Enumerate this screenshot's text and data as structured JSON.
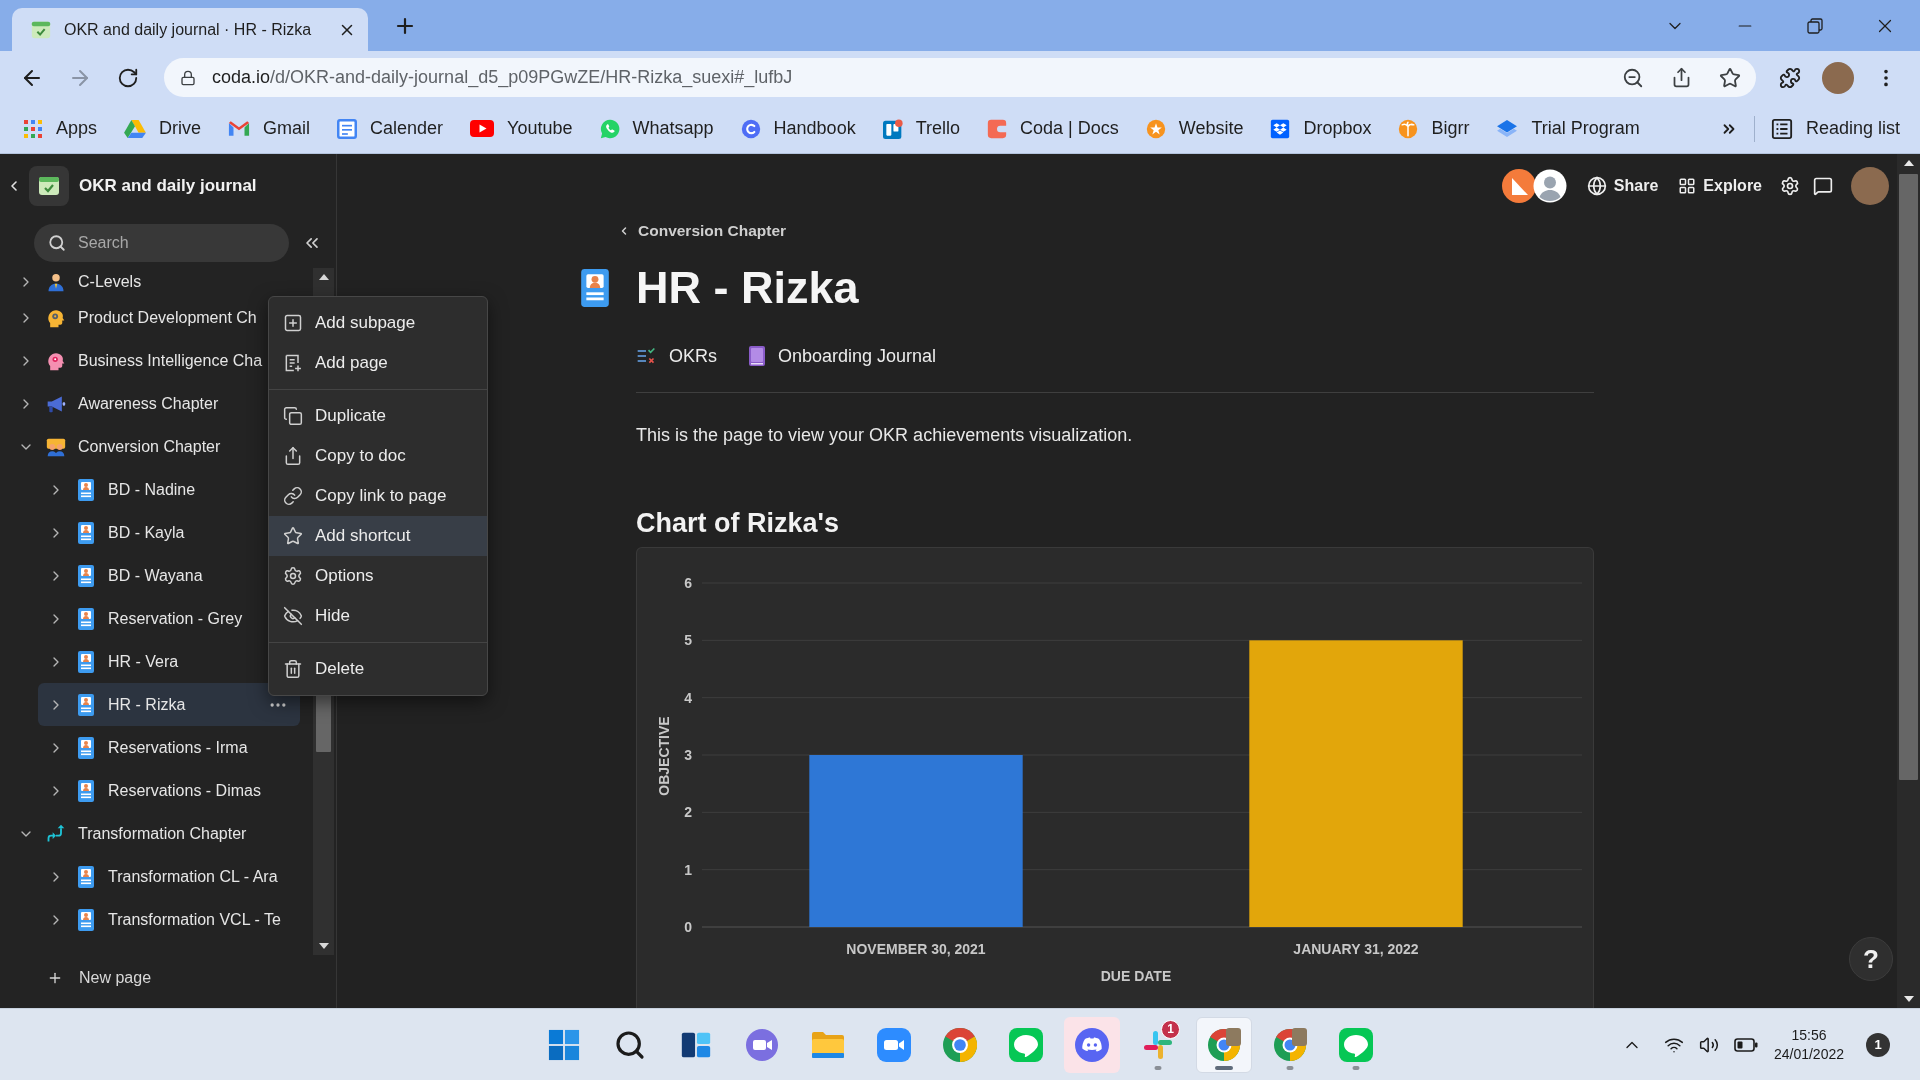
{
  "browser": {
    "tabs": [
      {
        "title": "OKR and daily journal · HR - Rizka",
        "selected": true
      }
    ],
    "can_go_forward": false,
    "address": {
      "host": "coda.io",
      "path": "/d/OKR-and-daily-journal_d5_p09PGwZE/HR-Rizka_suexi#_lufbJ"
    },
    "bookmarks": [
      {
        "label": "Apps",
        "kind": "grid"
      },
      {
        "label": "Drive",
        "kind": "triangle"
      },
      {
        "label": "Gmail",
        "kind": "mail"
      },
      {
        "label": "Calender",
        "kind": "calendar"
      },
      {
        "label": "Youtube",
        "kind": "play"
      },
      {
        "label": "Whatsapp",
        "kind": "phone"
      },
      {
        "label": "Handbook",
        "kind": "swirl"
      },
      {
        "label": "Trello",
        "kind": "board"
      },
      {
        "label": "Coda | Docs",
        "kind": "notch"
      },
      {
        "label": "Website",
        "kind": "star"
      },
      {
        "label": "Dropbox",
        "kind": "box"
      },
      {
        "label": "Bigrr",
        "kind": "palm"
      },
      {
        "label": "Trial Program",
        "kind": "layers"
      }
    ],
    "reading_list": "Reading list"
  },
  "sidebar": {
    "doc_title": "OKR and daily journal",
    "search": {
      "placeholder": "Search"
    },
    "pages": [
      {
        "label": "C-Levels",
        "kind": "leader",
        "expanded": false,
        "selected": false
      },
      {
        "label": "Product Development Ch",
        "kind": "mind",
        "expanded": false,
        "selected": false
      },
      {
        "label": "Business Intelligence Cha",
        "kind": "brain",
        "expanded": false,
        "selected": false
      },
      {
        "label": "Awareness Chapter",
        "kind": "megaphone",
        "expanded": false,
        "selected": false
      },
      {
        "label": "Conversion Chapter",
        "kind": "team",
        "expanded": true,
        "selected": false,
        "children": [
          {
            "label": "BD - Nadine",
            "kind": "card",
            "expanded": false,
            "selected": false
          },
          {
            "label": "BD - Kayla",
            "kind": "card",
            "expanded": false,
            "selected": false
          },
          {
            "label": "BD - Wayana",
            "kind": "card",
            "expanded": false,
            "selected": false
          },
          {
            "label": "Reservation - Grey",
            "kind": "card",
            "expanded": false,
            "selected": false
          },
          {
            "label": "HR - Vera",
            "kind": "card",
            "expanded": false,
            "selected": false
          },
          {
            "label": "HR - Rizka",
            "kind": "card",
            "expanded": false,
            "selected": true
          },
          {
            "label": "Reservations - Irma",
            "kind": "card",
            "expanded": false,
            "selected": false
          },
          {
            "label": "Reservations - Dimas",
            "kind": "card",
            "expanded": false,
            "selected": false
          }
        ]
      },
      {
        "label": "Transformation Chapter",
        "kind": "arrows",
        "expanded": true,
        "selected": false,
        "children": [
          {
            "label": "Transformation CL - Ara",
            "kind": "card",
            "expanded": false,
            "selected": false
          },
          {
            "label": "Transformation VCL - Te",
            "kind": "card",
            "expanded": false,
            "selected": false
          }
        ]
      }
    ],
    "new_page": "New page"
  },
  "context_menu": {
    "sections": [
      {
        "items": [
          {
            "label": "Add subpage",
            "kind": "subpage",
            "selected": false
          },
          {
            "label": "Add page",
            "kind": "page",
            "selected": false
          }
        ]
      },
      {
        "items": [
          {
            "label": "Duplicate",
            "kind": "duplicate",
            "selected": false
          },
          {
            "label": "Copy to doc",
            "kind": "export",
            "selected": false
          },
          {
            "label": "Copy link to page",
            "kind": "link",
            "selected": false
          },
          {
            "label": "Add shortcut",
            "kind": "shortcut",
            "selected": true
          },
          {
            "label": "Options",
            "kind": "options",
            "selected": false
          },
          {
            "label": "Hide",
            "kind": "hide",
            "selected": false
          }
        ]
      },
      {
        "items": [
          {
            "label": "Delete",
            "kind": "delete",
            "selected": false
          }
        ]
      }
    ]
  },
  "topbar": {
    "actions": [
      {
        "label": "Share",
        "kind": "globe"
      },
      {
        "label": "Explore",
        "kind": "grid"
      }
    ]
  },
  "page": {
    "breadcrumb": "Conversion Chapter",
    "title": "HR - Rizka",
    "subpages": [
      {
        "label": "OKRs",
        "kind": "checklist"
      },
      {
        "label": "Onboarding Journal",
        "kind": "book"
      }
    ],
    "intro": "This is the page to view your OKR achievements visualization.",
    "chart_heading": "Chart of Rizka's",
    "chart_data": {
      "type": "bar",
      "xlabel": "DUE DATE",
      "ylabel": "OBJECTIVE",
      "categories": [
        "NOVEMBER 30, 2021",
        "JANUARY 31, 2022"
      ],
      "values": [
        3,
        5
      ],
      "colors": [
        "#2e77d6",
        "#e2a60b"
      ],
      "ylim": [
        0,
        6
      ],
      "yticks": [
        0,
        1,
        2,
        3,
        4,
        5,
        6
      ],
      "grid": true
    }
  },
  "help_button": "?",
  "taskbar": {
    "apps": [
      {
        "kind": "start",
        "running": false,
        "active": false,
        "highlighted": false
      },
      {
        "kind": "search",
        "running": false,
        "active": false,
        "highlighted": false
      },
      {
        "kind": "widgets",
        "running": false,
        "active": false,
        "highlighted": false
      },
      {
        "kind": "chat",
        "running": false,
        "active": false,
        "highlighted": false
      },
      {
        "kind": "folder",
        "running": false,
        "active": false,
        "highlighted": false
      },
      {
        "kind": "video",
        "running": false,
        "active": false,
        "highlighted": false
      },
      {
        "kind": "browser",
        "running": false,
        "active": false,
        "highlighted": false
      },
      {
        "kind": "bubble",
        "running": false,
        "active": false,
        "highlighted": false
      },
      {
        "kind": "controller",
        "running": false,
        "active": false,
        "highlighted": true
      },
      {
        "kind": "pinwheel",
        "running": true,
        "active": false,
        "highlighted": false,
        "badge": "1"
      },
      {
        "kind": "profile",
        "running": true,
        "active": true,
        "highlighted": false
      },
      {
        "kind": "profile",
        "running": true,
        "active": false,
        "highlighted": false
      },
      {
        "kind": "bubble",
        "running": true,
        "active": false,
        "highlighted": false
      }
    ],
    "clock": {
      "time": "15:56",
      "date": "24/01/2022"
    },
    "notifications": "1"
  }
}
